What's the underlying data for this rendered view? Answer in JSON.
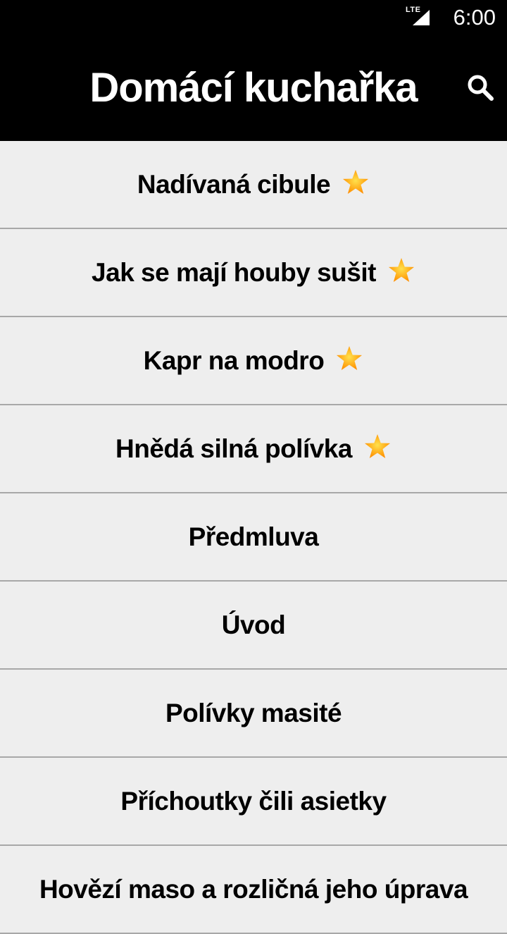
{
  "status_bar": {
    "network_label": "LTE",
    "signal_icon": "cell-signal-icon",
    "time": "6:00"
  },
  "app_bar": {
    "title": "Domácí kuchařka",
    "search_icon": "search-icon"
  },
  "colors": {
    "bar_background": "#000000",
    "list_background": "#eeeeee",
    "divider": "#a8a8a8",
    "star_fill": "#ffa000"
  },
  "recipes": [
    {
      "label": "Nadívaná cibule",
      "favorite": true
    },
    {
      "label": "Jak se mají houby sušit",
      "favorite": true
    },
    {
      "label": "Kapr na modro",
      "favorite": true
    },
    {
      "label": "Hnědá silná polívka",
      "favorite": true
    },
    {
      "label": "Předmluva",
      "favorite": false
    },
    {
      "label": "Úvod",
      "favorite": false
    },
    {
      "label": "Polívky masité",
      "favorite": false
    },
    {
      "label": "Příchoutky čili asietky",
      "favorite": false
    },
    {
      "label": "Hovězí maso a rozličná jeho úprava",
      "favorite": false
    }
  ]
}
